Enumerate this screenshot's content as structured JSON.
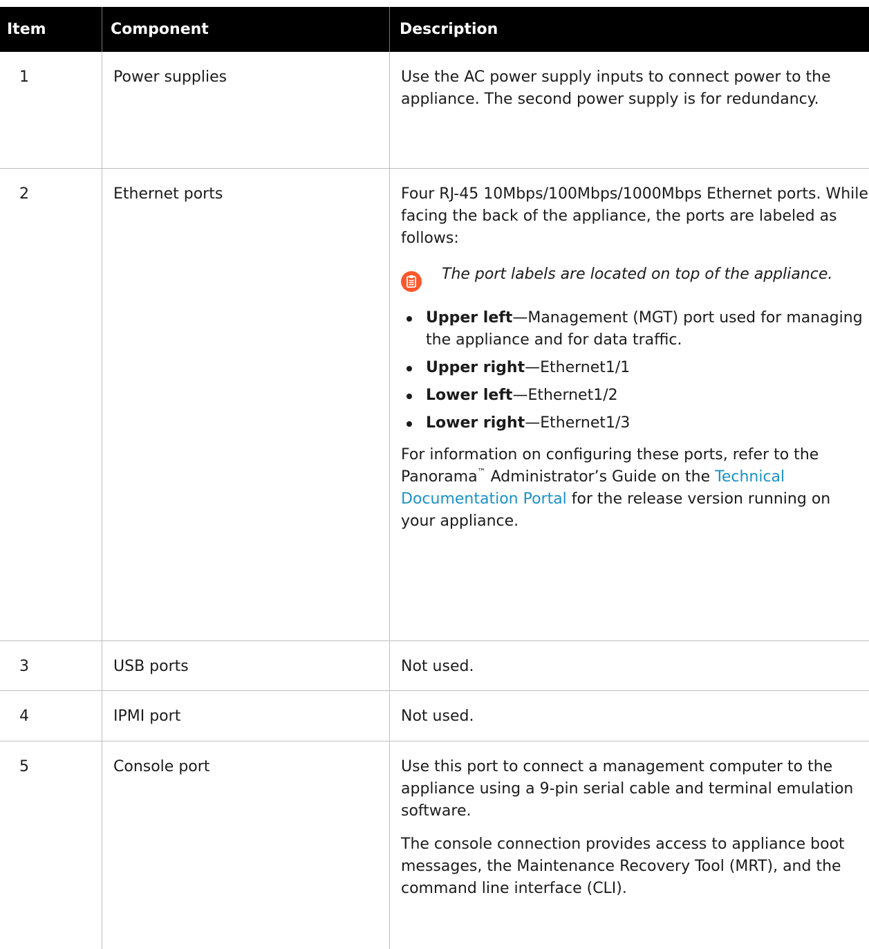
{
  "table": {
    "headers": [
      "Item",
      "Component",
      "Description"
    ],
    "rows": [
      {
        "item": "1",
        "component": "Power supplies",
        "description": [
          "Use the AC power supply inputs to connect power to the appliance. The second power supply is for redundancy."
        ]
      },
      {
        "item": "2",
        "component": "Ethernet ports",
        "intro": "Four RJ-45 10Mbps/100Mbps/1000Mbps Ethernet ports. While facing the back of the appliance, the ports are labeled as follows:",
        "note": {
          "icon": "clipboard-note-icon",
          "icon_color": "#fa582d",
          "text": "The port labels are located on top of the appliance."
        },
        "bullets": [
          {
            "label": "Upper left",
            "sep": "—",
            "text": "Management (MGT) port used for managing the appliance and for data traffic."
          },
          {
            "label": "Upper right",
            "sep": "—",
            "text": "Ethernet1/1"
          },
          {
            "label": "Lower left",
            "sep": "—",
            "text": "Ethernet1/2"
          },
          {
            "label": "Lower right",
            "sep": "—",
            "text": "Ethernet1/3"
          }
        ],
        "outro": {
          "before": "For information on configuring these ports, refer to the Panorama",
          "tm": "™",
          "mid": " Administrator’s Guide on the ",
          "link": "Technical Documentation Portal",
          "after": " for the release version running on your appliance."
        }
      },
      {
        "item": "3",
        "component": "USB ports",
        "description": [
          "Not used."
        ]
      },
      {
        "item": "4",
        "component": "IPMI port",
        "description": [
          "Not used."
        ]
      },
      {
        "item": "5",
        "component": "Console port",
        "description": [
          "Use this port to connect a management computer to the appliance using a 9-pin serial cable and terminal emulation software.",
          "The console connection provides access to appliance boot messages, the Maintenance Recovery Tool (MRT), and the command line interface (CLI)."
        ]
      }
    ]
  },
  "colors": {
    "header_bg": "#000000",
    "header_text": "#ffffff",
    "link": "#1b91c5",
    "note_icon": "#fa582d",
    "border": "#bdbdbd"
  }
}
